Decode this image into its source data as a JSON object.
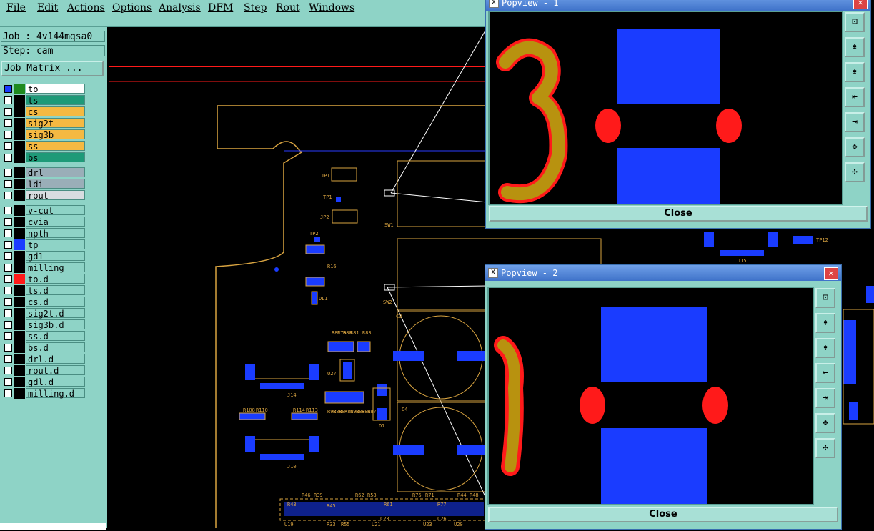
{
  "menu": [
    "File",
    "Edit",
    "Actions",
    "Options",
    "Analysis",
    "DFM",
    "Step",
    "Rout",
    "Windows"
  ],
  "job_label": "Job : 4v144mqsa0",
  "step_label": "Step: cam",
  "job_matrix_label": "Job Matrix ...",
  "layers": [
    {
      "name": "to",
      "color": "#ffffff",
      "swatch": "#1f8a1f"
    },
    {
      "name": "ts",
      "color": "#1e9a78",
      "swatch": "#000000"
    },
    {
      "name": "cs",
      "color": "#f5b942",
      "swatch": "#000000"
    },
    {
      "name": "sig2t",
      "color": "#f5b942",
      "swatch": "#000000"
    },
    {
      "name": "sig3b",
      "color": "#f5b942",
      "swatch": "#000000"
    },
    {
      "name": "ss",
      "color": "#f5b942",
      "swatch": "#000000"
    },
    {
      "name": "bs",
      "color": "#1e9a78",
      "swatch": "#000000"
    },
    {
      "name": "drl",
      "color": "#9aaeb8",
      "swatch": "#000000"
    },
    {
      "name": "ldi",
      "color": "#9aaeb8",
      "swatch": "#000000"
    },
    {
      "name": "rout",
      "color": "#d8dce0",
      "swatch": "#000000"
    },
    {
      "name": "v-cut",
      "color": "#8ed3c6",
      "swatch": "#000000"
    },
    {
      "name": "cvia",
      "color": "#8ed3c6",
      "swatch": "#000000"
    },
    {
      "name": "npth",
      "color": "#8ed3c6",
      "swatch": "#000000"
    },
    {
      "name": "tp",
      "color": "#8ed3c6",
      "swatch": "#1a3cff"
    },
    {
      "name": "gd1",
      "color": "#8ed3c6",
      "swatch": "#000000"
    },
    {
      "name": "milling",
      "color": "#8ed3c6",
      "swatch": "#000000"
    },
    {
      "name": "to.d",
      "color": "#8ed3c6",
      "swatch": "#ff1a1a"
    },
    {
      "name": "ts.d",
      "color": "#8ed3c6",
      "swatch": "#000000"
    },
    {
      "name": "cs.d",
      "color": "#8ed3c6",
      "swatch": "#000000"
    },
    {
      "name": "sig2t.d",
      "color": "#8ed3c6",
      "swatch": "#000000"
    },
    {
      "name": "sig3b.d",
      "color": "#8ed3c6",
      "swatch": "#000000"
    },
    {
      "name": "ss.d",
      "color": "#8ed3c6",
      "swatch": "#000000"
    },
    {
      "name": "bs.d",
      "color": "#8ed3c6",
      "swatch": "#000000"
    },
    {
      "name": "drl.d",
      "color": "#8ed3c6",
      "swatch": "#000000"
    },
    {
      "name": "rout.d",
      "color": "#8ed3c6",
      "swatch": "#000000"
    },
    {
      "name": "gdl.d",
      "color": "#8ed3c6",
      "swatch": "#000000"
    },
    {
      "name": "milling.d",
      "color": "#8ed3c6",
      "swatch": "#000000"
    }
  ],
  "popup1": {
    "title": "Popview - 1",
    "close_label": "Close"
  },
  "popup2": {
    "title": "Popview - 2",
    "close_label": "Close"
  },
  "board": {
    "refdes": [
      "JP1",
      "TP1",
      "JP2",
      "SW1",
      "TP2",
      "R16",
      "DL1",
      "SW2",
      "C3",
      "C4",
      "U27",
      "J14",
      "J10",
      "D7",
      "R108",
      "R110",
      "R114",
      "R113",
      "R82",
      "R79",
      "R80",
      "R81",
      "R83",
      "R92",
      "R88",
      "R84",
      "R85",
      "R93",
      "R89",
      "R86",
      "R87",
      "TP12",
      "J15",
      "R43",
      "R46",
      "R39",
      "R45",
      "R62",
      "R58",
      "R61",
      "R76",
      "R71",
      "R77",
      "R44",
      "R48",
      "U19",
      "R33",
      "R55",
      "U21",
      "C23",
      "U23",
      "C26",
      "U20"
    ]
  },
  "colors": {
    "pad": "#1a3cff",
    "silk": "#d9a441",
    "outline": "#ff1a1a",
    "copper": "#b8920f",
    "panel": "#8ed3c6"
  }
}
